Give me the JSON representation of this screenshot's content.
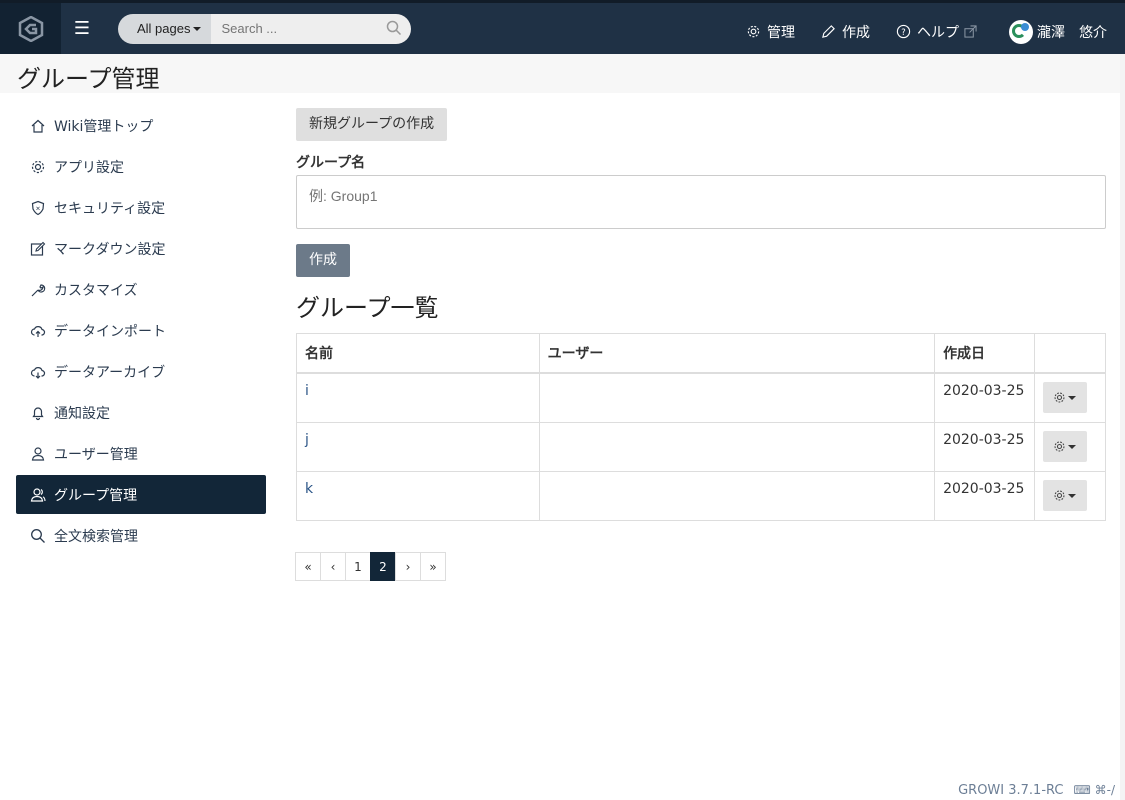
{
  "navbar": {
    "search_scope": "All pages",
    "search_placeholder": "Search ...",
    "admin_label": "管理",
    "create_label": "作成",
    "help_label": "ヘルプ",
    "user_name": "瀧澤　悠介"
  },
  "page": {
    "title": "グループ管理"
  },
  "sidebar": {
    "items": [
      {
        "label": "Wiki管理トップ"
      },
      {
        "label": "アプリ設定"
      },
      {
        "label": "セキュリティ設定"
      },
      {
        "label": "マークダウン設定"
      },
      {
        "label": "カスタマイズ"
      },
      {
        "label": "データインポート"
      },
      {
        "label": "データアーカイブ"
      },
      {
        "label": "通知設定"
      },
      {
        "label": "ユーザー管理"
      },
      {
        "label": "グループ管理"
      },
      {
        "label": "全文検索管理"
      }
    ],
    "active_index": 9
  },
  "main": {
    "new_group_label": "新規グループの作成",
    "group_name_label": "グループ名",
    "group_name_placeholder": "例: Group1",
    "create_button": "作成",
    "list_title": "グループ一覧",
    "table": {
      "headers": [
        "名前",
        "ユーザー",
        "作成日",
        ""
      ],
      "rows": [
        {
          "name": "i",
          "users": "",
          "created": "2020-03-25"
        },
        {
          "name": "j",
          "users": "",
          "created": "2020-03-25"
        },
        {
          "name": "k",
          "users": "",
          "created": "2020-03-25"
        }
      ]
    },
    "pagination": [
      "«",
      "‹",
      "1",
      "2",
      "›",
      "»"
    ],
    "current_page": "2"
  },
  "footer": {
    "version": "GROWI 3.7.1-RC",
    "shortcut": "⌨ ⌘-/"
  },
  "colors": {
    "navbar": "#1f3145",
    "sidebar_active": "#122638",
    "link": "#2b5587",
    "create_button": "#6c7a89"
  }
}
